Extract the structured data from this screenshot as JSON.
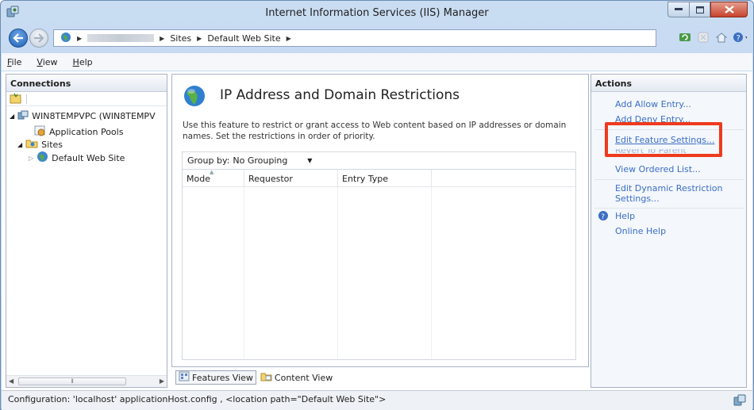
{
  "window": {
    "title": "Internet Information Services (IIS) Manager"
  },
  "address": {
    "crumbs": [
      "Sites",
      "Default Web Site"
    ]
  },
  "menu": {
    "items": [
      {
        "label": "File",
        "key": "F",
        "rest": "ile"
      },
      {
        "label": "View",
        "key": "V",
        "rest": "iew"
      },
      {
        "label": "Help",
        "key": "H",
        "rest": "elp"
      }
    ]
  },
  "connections": {
    "title": "Connections",
    "tree": {
      "server": "WIN8TEMPVPC (WIN8TEMPV",
      "app_pools": "Application Pools",
      "sites": "Sites",
      "site": "Default Web Site"
    }
  },
  "feature": {
    "title": "IP Address and Domain Restrictions",
    "description": "Use this feature to restrict or grant access to Web content based on IP addresses or domain names. Set the restrictions in order of priority.",
    "group_by_label": "Group by:",
    "group_by_value": "No Grouping",
    "columns": [
      "Mode",
      "Requestor",
      "Entry Type"
    ]
  },
  "views": {
    "features": "Features View",
    "content": "Content View"
  },
  "actions": {
    "title": "Actions",
    "add_allow": "Add Allow Entry...",
    "add_deny": "Add Deny Entry...",
    "edit_feature": "Edit Feature Settings...",
    "revert": "Revert To Parent",
    "view_ordered": "View Ordered List...",
    "edit_dynamic": "Edit Dynamic Restriction Settings...",
    "help": "Help",
    "online_help": "Online Help"
  },
  "status": {
    "text": "Configuration: 'localhost' applicationHost.config , <location path=\"Default Web Site\">"
  },
  "colors": {
    "highlight": "#ee3a1e",
    "link": "#3a6ec6"
  }
}
